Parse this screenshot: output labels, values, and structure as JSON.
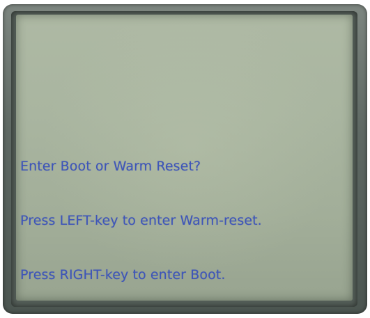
{
  "colors": {
    "lcd_background": "#a9b5a0",
    "lcd_text": "#3e55b8",
    "bezel": "#5f6964"
  },
  "screen": {
    "lines": [
      "Enter Boot or Warm Reset?",
      "Press LEFT-key to enter Warm-reset.",
      "Press RIGHT-key to enter Boot."
    ]
  }
}
